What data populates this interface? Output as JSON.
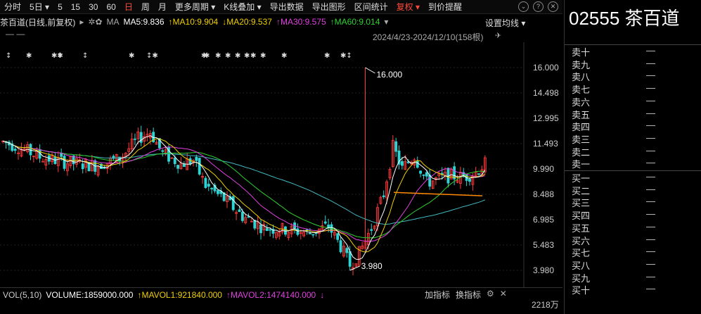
{
  "toolbar": {
    "items": [
      "分时",
      "5日 ▾",
      "5",
      "15",
      "30",
      "60",
      "日",
      "周",
      "月",
      "更多周期 ▾",
      "K线叠加 ▾",
      "导出数据",
      "导出图形",
      "区间统计",
      "复权 ▾",
      "到价提醒"
    ],
    "active_index": 6,
    "warn_index": 14,
    "icons": [
      "⌄",
      "?",
      "✕"
    ]
  },
  "info": {
    "name": "茶百道(日线,前复权)",
    "arrow": "▸",
    "gear": "✲✿",
    "ma_label": "MA",
    "ma5": "MA5:9.836",
    "ma10": "↑MA10:9.904",
    "ma20": "↓MA20:9.537",
    "ma30": "↑MA30:9.575",
    "ma60": "↑MA60:9.014",
    "dots": "▾",
    "setting": "设置均线 ▾",
    "dash": "— —",
    "range": "2024/4/23-2024/12/10(158根)",
    "pin": "✈"
  },
  "colors": {
    "up": "#ff3b3b",
    "down": "#2fd3d3",
    "ma5": "#ffffff",
    "ma10": "#f0d000",
    "ma20": "#e040e0",
    "ma30": "#30d030",
    "ma60": "#40b8c0",
    "hline": "#ff8a00"
  },
  "chart_data": {
    "type": "candlestick",
    "y_ticks": [
      "16.000",
      "14.498",
      "12.995",
      "11.493",
      "9.990",
      "8.488",
      "6.985",
      "5.483",
      "3.980"
    ],
    "y_range": [
      3.98,
      16.0
    ],
    "high_label": "16.000",
    "low_label": "3.980",
    "event_markers": [
      "↕",
      "✱",
      "✱✱",
      "↕",
      "↕",
      "✱",
      "↕✱",
      "✱",
      "✱",
      "✱",
      "✱",
      "✱",
      "✱",
      "✱",
      "✱",
      "✱",
      "✱",
      "✱↕"
    ]
  },
  "volume": {
    "label": "VOL(5,10)",
    "volume": "VOLUME:1859000.000",
    "mavol1": "↑MAVOL1:921840.000",
    "mavol2": "↑MAVOL2:1474140.000",
    "arrow": "↓",
    "btn1": "加指标",
    "btn2": "换指标",
    "axis": "2218万"
  },
  "panel": {
    "title": "02555 茶百道",
    "sell": [
      "卖十",
      "卖九",
      "卖八",
      "卖七",
      "卖六",
      "卖五",
      "卖四",
      "卖三",
      "卖二",
      "卖一"
    ],
    "buy": [
      "买一",
      "买二",
      "买三",
      "买四",
      "买五",
      "买六",
      "买七",
      "买八",
      "买九",
      "买十"
    ],
    "empty": "—"
  }
}
